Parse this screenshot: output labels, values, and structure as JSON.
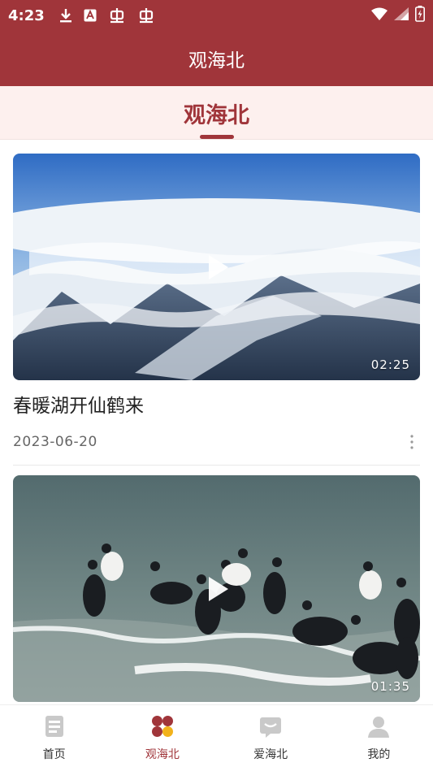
{
  "status_bar": {
    "time": "4:23",
    "icons": [
      "download-icon",
      "app-store-icon",
      "bug-icon",
      "bug-icon",
      "wifi-icon",
      "signal-icon",
      "battery-icon"
    ]
  },
  "app_bar": {
    "title": "观海北"
  },
  "tabs": [
    {
      "label": "观海北",
      "active": true
    }
  ],
  "feed": {
    "items": [
      {
        "title": "春暖湖开仙鹤来",
        "date": "2023-06-20",
        "duration": "02:25",
        "thumbnail": "mountains-above-clouds"
      },
      {
        "title": "",
        "date": "",
        "duration": "01:35",
        "thumbnail": "birds-on-lake-shore"
      }
    ]
  },
  "bottom_nav": {
    "items": [
      {
        "label": "首页",
        "icon": "home-doc-icon",
        "active": false
      },
      {
        "label": "观海北",
        "icon": "dots-grid-icon",
        "active": true
      },
      {
        "label": "爱海北",
        "icon": "message-icon",
        "active": false
      },
      {
        "label": "我的",
        "icon": "person-icon",
        "active": false
      }
    ]
  },
  "colors": {
    "primary": "#a0353a",
    "tab_bg": "#fdf0ee",
    "active_dot_accent": "#f2b21b"
  }
}
